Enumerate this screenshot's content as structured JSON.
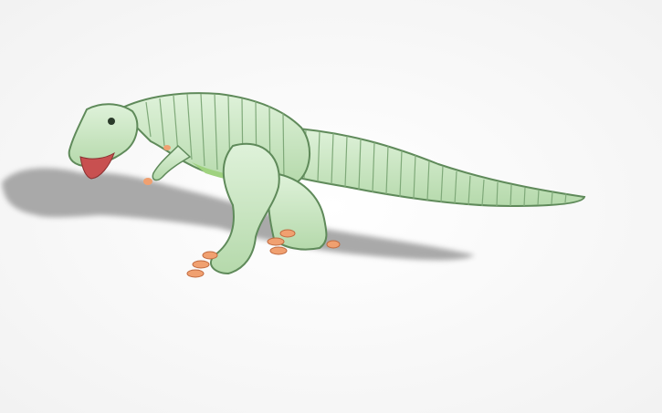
{
  "scene": {
    "subject": "dinosaur-3d-model",
    "colors": {
      "background": "#ffffff",
      "body": "#c8e6c0",
      "body_outline": "#5f8a5a",
      "belly": "#9fd27f",
      "claws": "#f0a070",
      "mouth": "#c85050",
      "shadow": "#a8a8a8"
    }
  }
}
